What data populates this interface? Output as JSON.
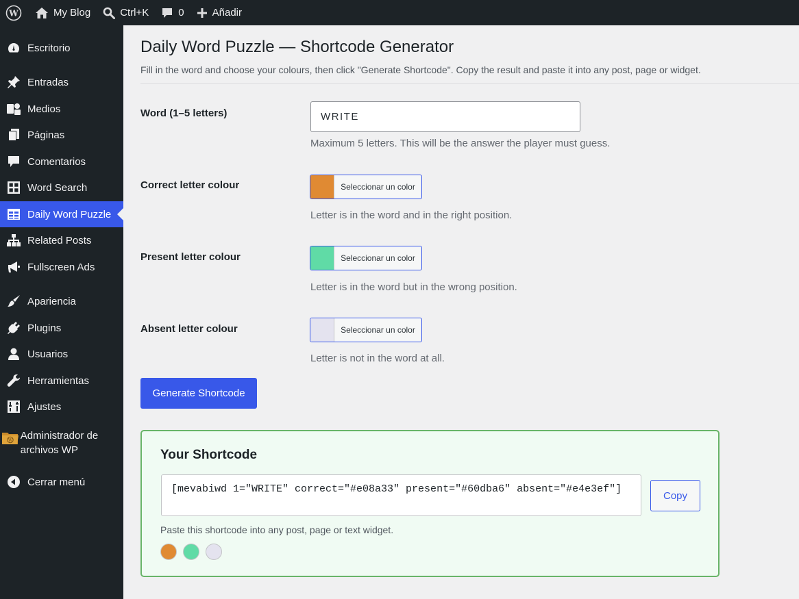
{
  "adminbar": {
    "site_name": "My Blog",
    "search_shortcut": "Ctrl+K",
    "comments_count": "0",
    "add_new": "Añadir"
  },
  "sidebar": {
    "items": [
      {
        "label": "Escritorio",
        "icon": "dashboard-icon"
      },
      {
        "label": "Entradas",
        "icon": "pin-icon"
      },
      {
        "label": "Medios",
        "icon": "media-icon"
      },
      {
        "label": "Páginas",
        "icon": "pages-icon"
      },
      {
        "label": "Comentarios",
        "icon": "comment-icon"
      },
      {
        "label": "Word Search",
        "icon": "grid-icon"
      },
      {
        "label": "Daily Word Puzzle",
        "icon": "table-icon"
      },
      {
        "label": "Related Posts",
        "icon": "sitemap-icon"
      },
      {
        "label": "Fullscreen Ads",
        "icon": "megaphone-icon"
      },
      {
        "label": "Apariencia",
        "icon": "brush-icon"
      },
      {
        "label": "Plugins",
        "icon": "plugin-icon"
      },
      {
        "label": "Usuarios",
        "icon": "user-icon"
      },
      {
        "label": "Herramientas",
        "icon": "wrench-icon"
      },
      {
        "label": "Ajustes",
        "icon": "settings-icon"
      },
      {
        "label": "Administrador de archivos WP",
        "icon": "folder-icon"
      },
      {
        "label": "Cerrar menú",
        "icon": "collapse-icon"
      }
    ],
    "current": "Daily Word Puzzle"
  },
  "main": {
    "title": "Daily Word Puzzle — Shortcode Generator",
    "description": "Fill in the word and choose your colours, then click \"Generate Shortcode\". Copy the result and paste it into any post, page or widget.",
    "word_label": "Word (1–5 letters)",
    "word_value": "WRITE",
    "word_help": "Maximum 5 letters. This will be the answer the player must guess.",
    "correct_label": "Correct letter colour",
    "correct_help": "Letter is in the word and in the right position.",
    "present_label": "Present letter colour",
    "present_help": "Letter is in the word but in the wrong position.",
    "absent_label": "Absent letter colour",
    "absent_help": "Letter is not in the word at all.",
    "color_button_label": "Seleccionar un color",
    "generate_label": "Generate Shortcode",
    "result": {
      "title": "Your Shortcode",
      "shortcode": "[mevabiwd 1=\"WRITE\" correct=\"#e08a33\" present=\"#60dba6\" absent=\"#e4e3ef\"]",
      "copy_label": "Copy",
      "note": "Paste this shortcode into any post, page or text widget."
    }
  },
  "colors": {
    "correct": "#e08a33",
    "present": "#60dba6",
    "absent": "#e4e3ef",
    "accent": "#3858e9",
    "adminbar_bg": "#1d2327"
  }
}
